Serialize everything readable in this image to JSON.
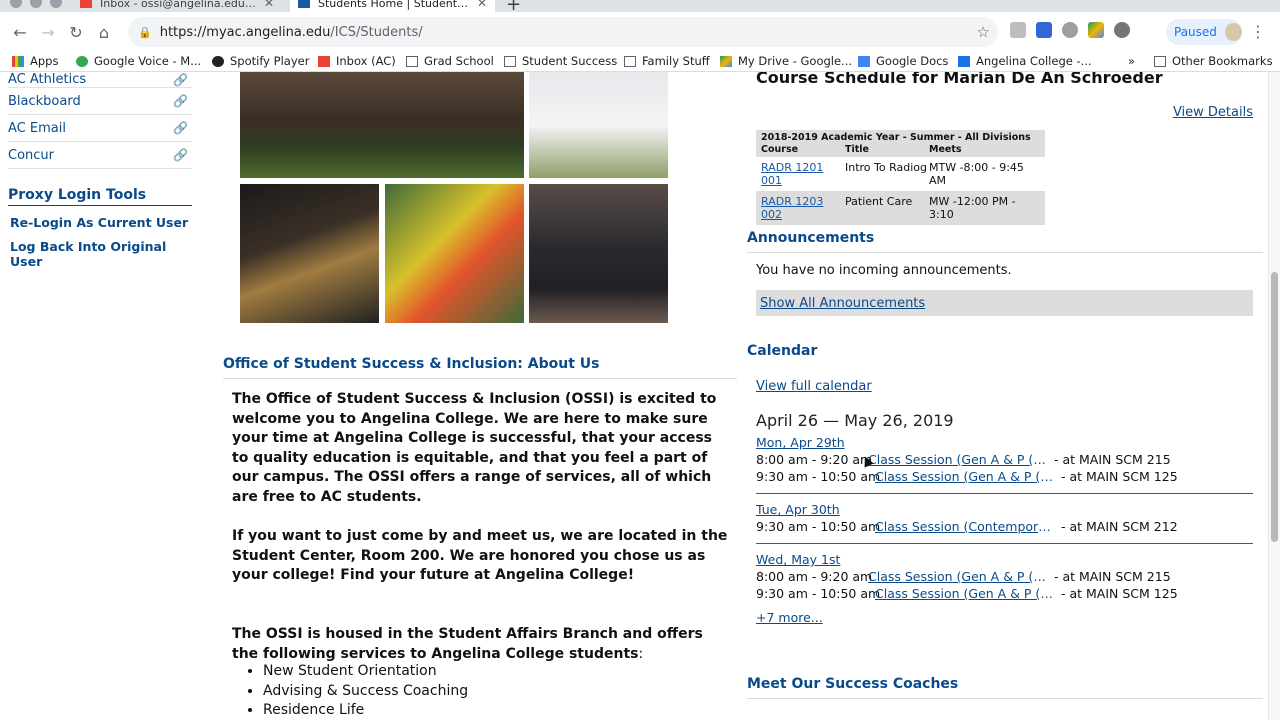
{
  "browser": {
    "tabs": [
      {
        "title": "Inbox - ossi@angelina.edu - A",
        "active": false
      },
      {
        "title": "Students Home | Students | Po",
        "active": true
      }
    ],
    "new_tab_label": "+",
    "url_host": "https://myac.angelina.edu",
    "url_path": "/ICS/Students/",
    "paused_label": "Paused",
    "bookmarks": [
      {
        "label": "Apps",
        "icon": "apps-grid-icon"
      },
      {
        "label": "Google Voice - M...",
        "icon": "google-voice-icon"
      },
      {
        "label": "Spotify Player",
        "icon": "spotify-icon"
      },
      {
        "label": "Inbox (AC)",
        "icon": "gmail-icon"
      },
      {
        "label": "Grad School",
        "icon": "folder-icon"
      },
      {
        "label": "Student Success",
        "icon": "folder-icon"
      },
      {
        "label": "Family Stuff",
        "icon": "folder-icon"
      },
      {
        "label": "My Drive - Google...",
        "icon": "google-drive-icon"
      },
      {
        "label": "Google Docs",
        "icon": "google-docs-icon"
      },
      {
        "label": "Angelina College -...",
        "icon": "calendar-icon"
      }
    ],
    "bookmarks_overflow": "»",
    "other_bookmarks": "Other Bookmarks"
  },
  "left_nav": {
    "links": [
      "AC Athletics",
      "Blackboard",
      "AC Email",
      "Concur"
    ],
    "proxy_title": "Proxy Login Tools",
    "proxy_links": [
      "Re-Login As Current User",
      "Log Back Into Original User"
    ]
  },
  "about": {
    "title": "Office of Student Success & Inclusion: About Us",
    "para1": "The Office of Student Success & Inclusion (OSSI) is excited to welcome you to Angelina College. We are here to make sure your time at Angelina College is successful, that your access to quality education is equitable, and that you feel a part of our campus. The OSSI offers a range of services, all of which are free to AC students.",
    "para2": "If you want to just come by and meet us, we are located in the Student Center, Room 200. We are honored you chose us as your college! Find your future at Angelina College!",
    "para3": "The OSSI is housed in the Student Affairs Branch and offers the following services to Angelina College students",
    "para3_colon": ":",
    "services": [
      "New Student Orientation",
      "Advising & Success Coaching",
      "Residence Life"
    ]
  },
  "schedule": {
    "title": "Course Schedule for Marian De An Schroeder",
    "view_details": "View Details",
    "term": "2018-2019 Academic Year - Summer - All Divisions",
    "columns": [
      "Course",
      "Title",
      "Meets"
    ],
    "rows": [
      {
        "course": "RADR 1201 001",
        "title": "Intro To Radiog",
        "meets": "MTW -8:00 - 9:45 AM"
      },
      {
        "course": "RADR 1203 002",
        "title": "Patient Care",
        "meets": "MW -12:00 PM - 3:10"
      }
    ]
  },
  "announcements": {
    "title": "Announcements",
    "empty_text": "You have no incoming announcements.",
    "show_all": "Show All Announcements"
  },
  "calendar": {
    "title": "Calendar",
    "view_full": "View full calendar",
    "range": "April 26 — May 26, 2019",
    "days": [
      {
        "label": "Mon, Apr 29th",
        "events": [
          {
            "time": "8:00 am - 9:20 am",
            "name": "Class Session (Gen A & P (B...",
            "location": "- at MAIN SCM 215"
          },
          {
            "time": "9:30 am - 10:50 am",
            "name": "Class Session (Gen A & P (B...",
            "location": "- at MAIN SCM 125"
          }
        ]
      },
      {
        "label": "Tue, Apr 30th",
        "events": [
          {
            "time": "9:30 am - 10:50 am",
            "name": "Class Session (Contempora...",
            "location": "- at MAIN SCM 212"
          }
        ]
      },
      {
        "label": "Wed, May 1st",
        "events": [
          {
            "time": "8:00 am - 9:20 am",
            "name": "Class Session (Gen A & P (B...",
            "location": "- at MAIN SCM 215"
          },
          {
            "time": "9:30 am - 10:50 am",
            "name": "Class Session (Gen A & P (B...",
            "location": "- at MAIN SCM 125"
          }
        ]
      }
    ],
    "more": "+7 more..."
  },
  "coaches": {
    "title": "Meet Our Success Coaches"
  },
  "colors": {
    "link_blue": "#0a4a8a",
    "chrome_gray": "#dee1e6"
  }
}
